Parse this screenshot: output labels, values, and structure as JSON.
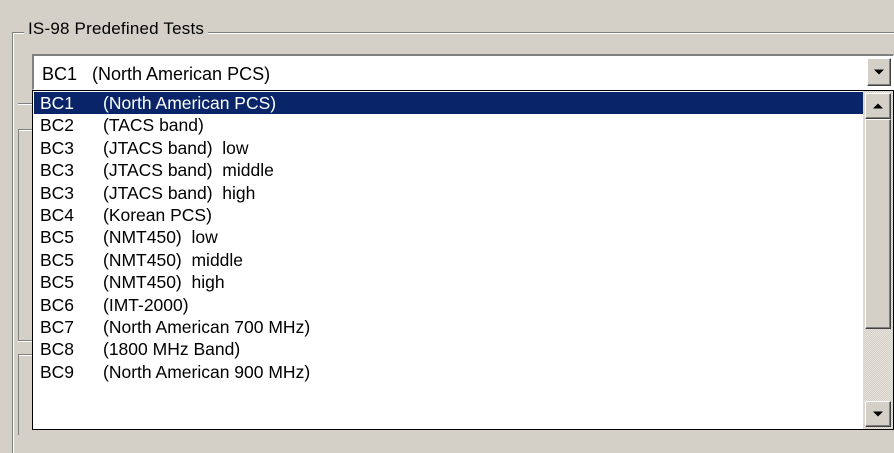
{
  "groupbox": {
    "title": "IS-98 Predefined Tests"
  },
  "combo": {
    "selected": "BC1   (North American PCS)"
  },
  "dropdown": {
    "items": [
      {
        "code": "BC1",
        "desc": "(North American PCS)",
        "selected": true
      },
      {
        "code": "BC2",
        "desc": "(TACS band)",
        "selected": false
      },
      {
        "code": "BC3",
        "desc": "(JTACS band)  low",
        "selected": false
      },
      {
        "code": "BC3",
        "desc": "(JTACS band)  middle",
        "selected": false
      },
      {
        "code": "BC3",
        "desc": "(JTACS band)  high",
        "selected": false
      },
      {
        "code": "BC4",
        "desc": "(Korean PCS)",
        "selected": false
      },
      {
        "code": "BC5",
        "desc": "(NMT450)  low",
        "selected": false
      },
      {
        "code": "BC5",
        "desc": "(NMT450)  middle",
        "selected": false
      },
      {
        "code": "BC5",
        "desc": "(NMT450)  high",
        "selected": false
      },
      {
        "code": "BC6",
        "desc": "(IMT-2000)",
        "selected": false
      },
      {
        "code": "BC7",
        "desc": "(North American 700 MHz)",
        "selected": false
      },
      {
        "code": "BC8",
        "desc": "(1800 MHz Band)",
        "selected": false
      },
      {
        "code": "BC9",
        "desc": "(North American 900 MHz)",
        "selected": false
      }
    ]
  },
  "icons": {
    "combo_button": "chevron-down-icon",
    "scroll_up": "scroll-up-arrow-icon",
    "scroll_down": "scroll-down-arrow-icon"
  },
  "colors": {
    "background": "#d4d0c8",
    "selection": "#0a246a",
    "selection_text": "#ffffff"
  }
}
